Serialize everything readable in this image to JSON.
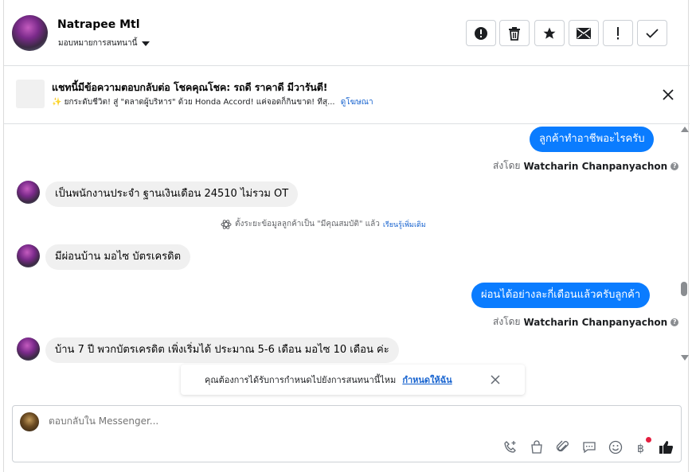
{
  "header": {
    "contact_name": "Natrapee Mtl",
    "assign_label": "มอบหมายการสนทนานี้",
    "toolbar": [
      {
        "name": "mark-spam-button",
        "icon": "alert-circle-icon"
      },
      {
        "name": "delete-button",
        "icon": "trash-icon"
      },
      {
        "name": "star-button",
        "icon": "star-icon"
      },
      {
        "name": "mark-unread-button",
        "icon": "envelope-icon"
      },
      {
        "name": "follow-up-button",
        "icon": "exclamation-icon"
      },
      {
        "name": "mark-done-button",
        "icon": "checkmark-icon"
      }
    ]
  },
  "banner": {
    "title": "แชทนี้มีข้อความตอบกลับต่อ โชคคุณโชค: รถดี ราคาดี มีวารันตี!",
    "subtitle_emoji": "✨",
    "subtitle": "ยกระดับชีวิต! สู่ \"ตลาดผู้บริหาร\" ด้วย Honda Accord! แค่จอดก็กินขาด! ทีสุ...",
    "link": "ดูโฆษณา"
  },
  "messages": [
    {
      "direction": "out",
      "text": "ลูกค้าทำอาชีพอะไรครับ",
      "sent_by_label": "ส่งโดย",
      "sent_by": "Watcharin Chanpanyachon"
    },
    {
      "direction": "in",
      "text": "เป็นพนักงานประจำ ฐานเงินเดือน 24510 ไม่รวม OT"
    },
    {
      "direction": "system",
      "text": "ตั้งระยะข้อมูลลูกค้าเป็น \"มีคุณสมบัติ\" แล้ว",
      "link": "เรียนรู้เพิ่มเติม"
    },
    {
      "direction": "in",
      "text": "มีผ่อนบ้าน มอไซ บัตรเครดิต"
    },
    {
      "direction": "out",
      "text": "ผ่อนได้อย่างละกี่เดือนแล้วครับลูกค้า",
      "sent_by_label": "ส่งโดย",
      "sent_by": "Watcharin Chanpanyachon"
    },
    {
      "direction": "in",
      "text": "บ้าน 7 ปี พวกบัตรเครดิต เพิ่งเริ่มได้ ประมาณ 5-6 เดือน มอไซ 10 เดือน ค่ะ"
    }
  ],
  "toast": {
    "text": "คุณต้องการได้รับการกำหนดไปยังการสนทนานี้ไหม",
    "link": "กำหนดให้ฉัน"
  },
  "composer": {
    "placeholder": "ตอบกลับใน Messenger...",
    "tools": [
      "phone-plus-icon",
      "shopping-bag-icon",
      "paperclip-icon",
      "saved-reply-icon",
      "emoji-icon",
      "baht-payment-icon",
      "thumbs-up-icon"
    ]
  },
  "colors": {
    "accent": "#0a7cff",
    "link": "#1763cf",
    "incoming_bubble": "#f0f0f0",
    "thumbs_up": "#1c1e21"
  }
}
